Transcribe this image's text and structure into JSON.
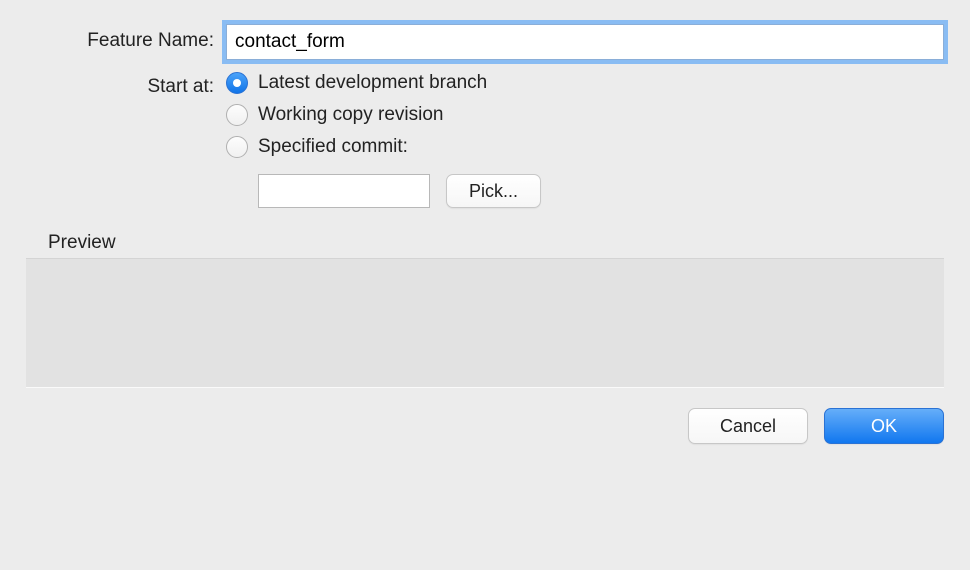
{
  "labels": {
    "feature_name": "Feature Name:",
    "start_at": "Start at:",
    "preview": "Preview"
  },
  "feature_name_input": {
    "value": "contact_form"
  },
  "radio_options": {
    "latest_dev": "Latest development branch",
    "working_copy": "Working copy revision",
    "specified_commit": "Specified commit:"
  },
  "commit_input": {
    "value": ""
  },
  "buttons": {
    "pick": "Pick...",
    "cancel": "Cancel",
    "ok": "OK"
  }
}
